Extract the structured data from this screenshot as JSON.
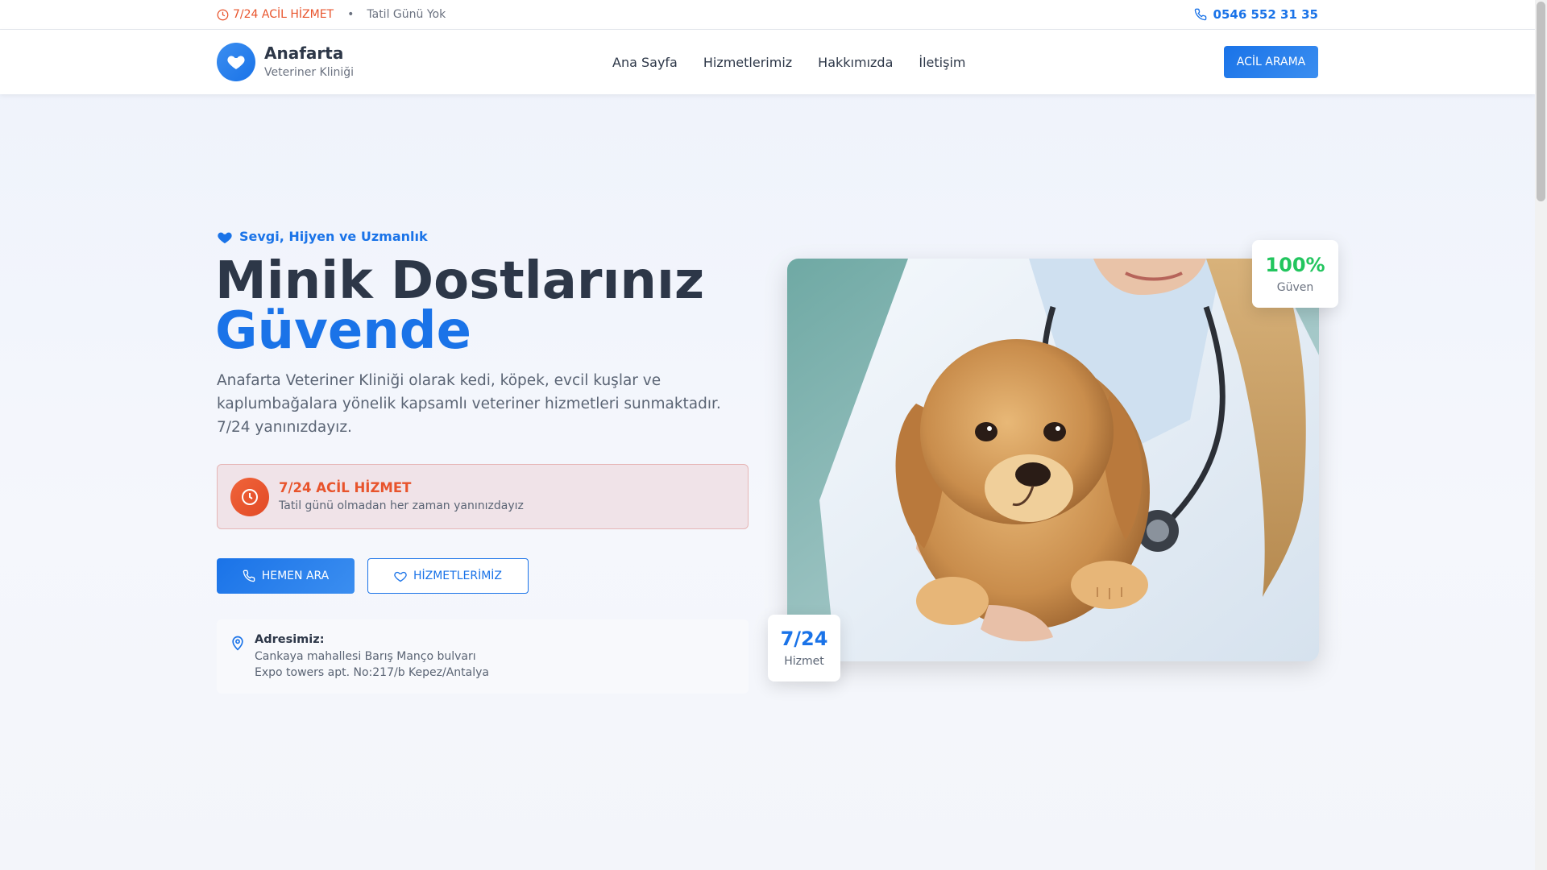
{
  "topbar": {
    "emergency": "7/24 ACİL HİZMET",
    "separator": "•",
    "holiday": "Tatil Günü Yok",
    "phone": "0546 552 31 35"
  },
  "header": {
    "brand_name": "Anafarta",
    "brand_sub": "Veteriner Kliniği",
    "nav": [
      "Ana Sayfa",
      "Hizmetlerimiz",
      "Hakkımızda",
      "İletişim"
    ],
    "cta": "ACİL ARAMA"
  },
  "hero": {
    "tagline": "Sevgi, Hijyen ve Uzmanlık",
    "title_line1": "Minik Dostlarınız",
    "title_line2": "Güvende",
    "lead": "Anafarta Veteriner Kliniği olarak kedi, köpek, evcil kuşlar ve kaplumbağalara yönelik kapsamlı veteriner hizmetleri sunmaktadır. 7/24 yanınızdayız.",
    "emergency_title": "7/24 ACİL HİZMET",
    "emergency_sub": "Tatil günü olmadan her zaman yanınızdayız",
    "btn_call": "HEMEN ARA",
    "btn_services": "HİZMETLERİMİZ",
    "address_title": "Adresimiz:",
    "address_line1": "Cankaya mahallesi Barış Manço bulvarı",
    "address_line2": "Expo towers apt. No:217/b Kepez/Antalya",
    "badge_top_value": "100%",
    "badge_top_label": "Güven",
    "badge_bottom_value": "7/24",
    "badge_bottom_label": "Hizmet"
  },
  "icons": {
    "clock": "clock-icon",
    "phone": "phone-icon",
    "heart": "heart-icon",
    "pin": "map-pin-icon"
  },
  "colors": {
    "primary": "#1a73e8",
    "emergency": "#e8542c",
    "success": "#22c55e",
    "text": "#2d3748"
  }
}
